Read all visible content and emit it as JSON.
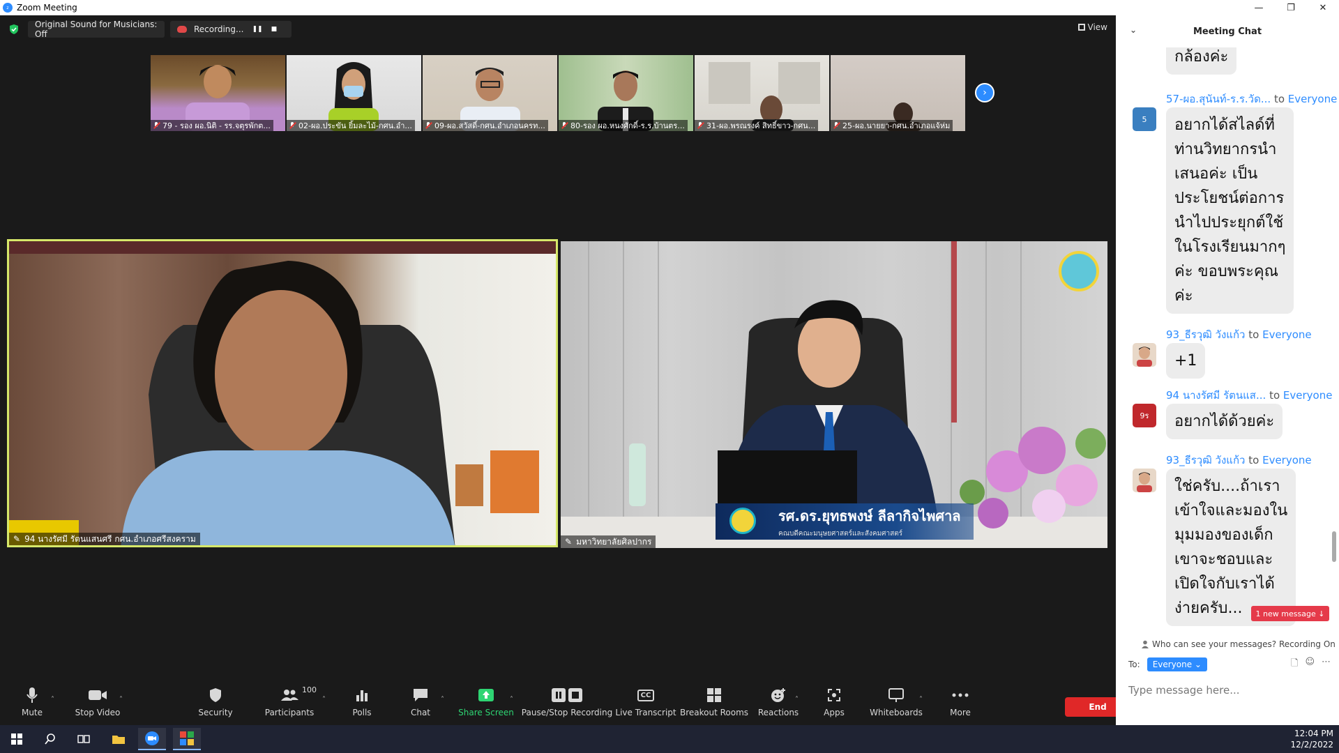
{
  "window": {
    "title": "Zoom Meeting",
    "controls": [
      "—",
      "❐",
      "✕"
    ]
  },
  "top_bar": {
    "original_sound": "Original Sound for Musicians: Off",
    "recording": "Recording...",
    "pause_glyph": "❚❚",
    "stop_glyph": "■",
    "view": "View"
  },
  "thumbnails": [
    {
      "name": "79 - รอง ผอ.นิติ - รร.จตุรพักต..."
    },
    {
      "name": "02-ผอ.ประขัน ยิ้มละไม้-กศน.อำ..."
    },
    {
      "name": "09-ผอ.สวัสดิ์-กศน.อำเภอนครท..."
    },
    {
      "name": "80-รอง ผอ.หนงศักดิ์-ร.ร.บ้านตร..."
    },
    {
      "name": "31-ผอ.พรณรงค์ สิทธิ์ขาว-กศน..."
    },
    {
      "name": "25-ผอ.นายยา-กศน.อำเภอแจ้ห่ม"
    }
  ],
  "next_arrow": "›",
  "speakers": {
    "left_label": "94 นางรัศมี รัตนแสนศรี กศน.อำเภอศรีสงคราม",
    "right_label": "มหาวิทยาลัยศิลปากร",
    "nameplate_name": "รศ.ดร.ยุทธพงษ์ ลีลากิจไพศาล",
    "nameplate_sub": "คณบดีคณะมนุษยศาสตร์และสังคมศาสตร์"
  },
  "toolbar": {
    "mute": "Mute",
    "stop_video": "Stop Video",
    "security": "Security",
    "participants": "Participants",
    "participants_count": "100",
    "polls": "Polls",
    "chat": "Chat",
    "share_screen": "Share Screen",
    "pause_stop_recording": "Pause/Stop Recording",
    "live_transcript": "Live Transcript",
    "cc": "CC",
    "breakout_rooms": "Breakout Rooms",
    "reactions": "Reactions",
    "apps": "Apps",
    "whiteboards": "Whiteboards",
    "more": "More",
    "end": "End"
  },
  "chat": {
    "title": "Meeting Chat",
    "to_word": "to",
    "messages": [
      {
        "sender": "",
        "to": "",
        "avatar": "",
        "text": "กล้องค่ะ"
      },
      {
        "sender": "57-ผอ.สุนันท์-ร.ร.วัด...",
        "to": "Everyone",
        "avatar": "5",
        "text": "อยากได้สไลด์ที่\nท่านวิทยากรนำ\nเสนอค่ะ เป็น\nประโยชน์ต่อการ\nนำไปประยุกต์ใช้\nในโรงเรียนมากๆ\nค่ะ ขอบพระคุณ\nค่ะ"
      },
      {
        "sender": "93_ธีรวุฒิ วังแก้ว",
        "to": "Everyone",
        "avatar": "",
        "text": "+1"
      },
      {
        "sender": "94 นางรัศมี รัตนแส...",
        "to": "Everyone",
        "avatar": "9ร",
        "text": "อยากได้ด้วยค่ะ"
      },
      {
        "sender": "93_ธีรวุฒิ วังแก้ว",
        "to": "Everyone",
        "avatar": "",
        "text": "ใช่ครับ....ถ้าเรา\nเข้าใจและมองใน\nมุมมองของเด็ก\nเขาจะชอบและ\nเปิดใจกับเราได้\nง่ายครับ..."
      }
    ],
    "new_message": "1 new message ↓",
    "who_can_see": "Who can see your messages? Recording On",
    "to_label": "To:",
    "recipient": "Everyone ⌄",
    "input_placeholder": "Type message here..."
  },
  "taskbar": {
    "time": "12:04 PM",
    "date": "12/2/2022"
  },
  "colors": {
    "zoom_blue": "#2d8cff",
    "active_speaker_border": "#d6e86a",
    "end_red": "#e02828",
    "share_green": "#2ed573",
    "new_message_red": "#e53a4a"
  }
}
